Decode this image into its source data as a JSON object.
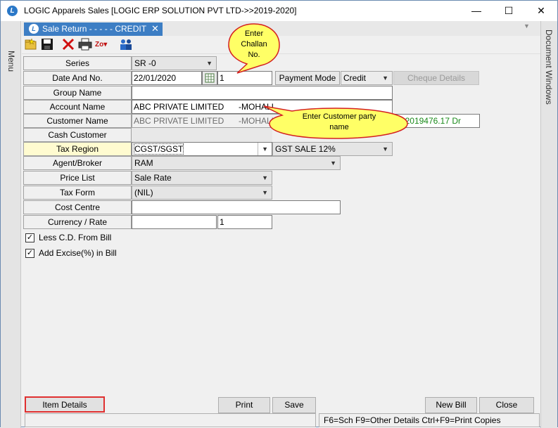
{
  "window": {
    "app_icon": "L",
    "title": "LOGIC Apparels Sales  [LOGIC ERP SOLUTION PVT LTD->>2019-2020]",
    "minimize": "—",
    "maximize": "☐",
    "close": "✕"
  },
  "side": {
    "left_label": "Menu",
    "right_label": "Document Windows"
  },
  "tab": {
    "label": "Sale Return - - - - - CREDIT",
    "close": "✕"
  },
  "toolbar": {
    "z_label": "Zo▾"
  },
  "form": {
    "series": {
      "label": "Series",
      "value": "SR -0"
    },
    "date_no": {
      "label": "Date And No.",
      "date": "22/01/2020",
      "number": "1"
    },
    "payment_mode": {
      "label": "Payment Mode",
      "value": "Credit"
    },
    "cheque_button": "Cheque Details",
    "group_name": {
      "label": "Group Name",
      "value": ""
    },
    "account_name": {
      "label": "Account Name",
      "value": "ABC PRIVATE LIMITED",
      "city": "-MOHALI"
    },
    "customer_name": {
      "label": "Customer Name",
      "value": "ABC PRIVATE LIMITED",
      "city": "-MOHALI",
      "balance": "2019476.17 Dr"
    },
    "cash_customer": {
      "label": "Cash Customer",
      "value": ""
    },
    "tax_region": {
      "label": "Tax Region",
      "value": "CGST/SGST",
      "gst": "GST SALE 12%"
    },
    "agent": {
      "label": "Agent/Broker",
      "value": "RAM"
    },
    "price_list": {
      "label": "Price List",
      "value": "Sale Rate"
    },
    "tax_form": {
      "label": "Tax Form",
      "value": "(NIL)"
    },
    "cost_centre": {
      "label": "Cost Centre",
      "value": ""
    },
    "currency": {
      "label": "Currency / Rate",
      "value": "",
      "rate": "1"
    },
    "less_cd": {
      "label": "Less C.D. From Bill",
      "checked": true,
      "mark": "✓"
    },
    "add_excise": {
      "label": "Add Excise(%) in Bill",
      "checked": true,
      "mark": "✓"
    }
  },
  "callouts": {
    "challan": [
      "Enter",
      "Challan",
      "No."
    ],
    "customer": [
      "Enter  Customer  party",
      "name"
    ]
  },
  "buttons": {
    "item_details": "Item Details",
    "print": "Print",
    "save": "Save",
    "new_bill": "New Bill",
    "close": "Close"
  },
  "status": {
    "shortcuts": "F6=Sch  F9=Other Details  Ctrl+F9=Print Copies"
  },
  "colors": {
    "tab_blue": "#3d7ec4",
    "balance_green": "#1a8a1a",
    "callout_fill": "#ffff66",
    "callout_border": "#d42020",
    "highlight": "#fffbd0"
  }
}
